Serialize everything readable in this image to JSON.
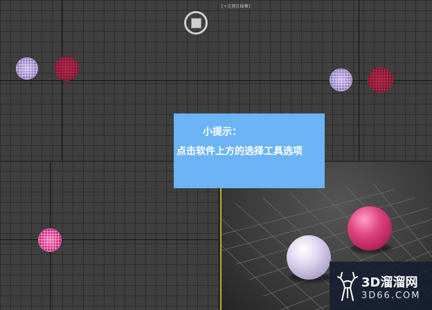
{
  "viewport": {
    "top_label": "[+][顶][线框]"
  },
  "tip": {
    "title": "小提示：",
    "body": "点击软件上方的选择工具选项"
  },
  "watermark": {
    "name": "3D溜溜网",
    "domain": "3D66.COM"
  },
  "colors": {
    "tip_background": "#6cb4f5",
    "active_viewport_border": "#c9a62c",
    "sphere_lavender": "#c9b3ea",
    "sphere_red": "#b8163f",
    "sphere_magenta": "#e0447f"
  },
  "icons": {
    "viewcube": "viewcube-icon",
    "logo": "deer-logo-icon"
  }
}
